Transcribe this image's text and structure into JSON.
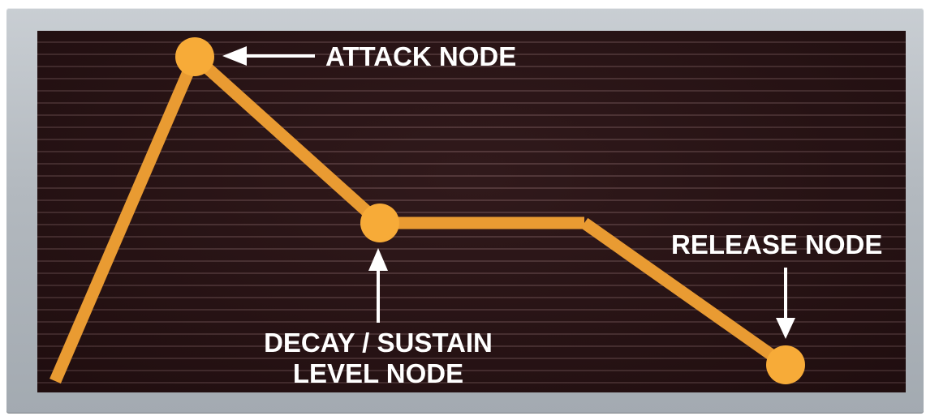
{
  "labels": {
    "attack": "ATTACK NODE",
    "decay_line1": "DECAY / SUSTAIN",
    "decay_line2": "LEVEL NODE",
    "release": "RELEASE NODE"
  },
  "colors": {
    "envelope": "#e99b32",
    "node": "#f7ab38",
    "screen": "#2a1214",
    "grid": "#4e3234",
    "bezel": "#b3b9bf",
    "label": "#ffffff"
  }
}
